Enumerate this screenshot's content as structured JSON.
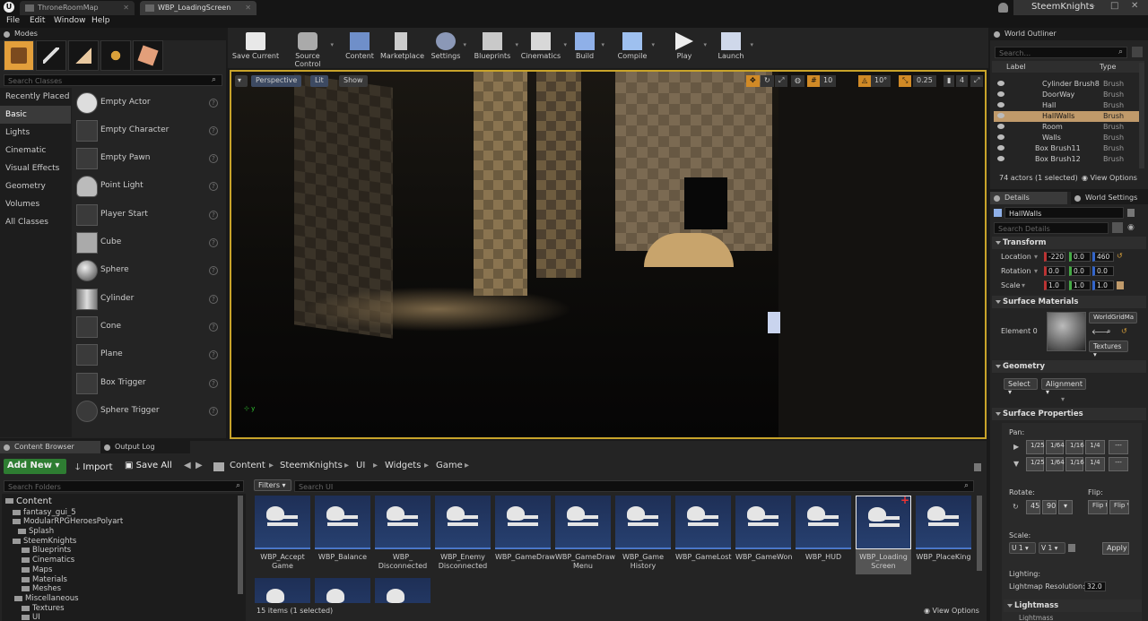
{
  "titlebar": {
    "tabs": [
      "ThroneRoomMap",
      "WBP_LoadingScreen"
    ],
    "project_name": "SteemKnights"
  },
  "menubar": [
    "File",
    "Edit",
    "Window",
    "Help"
  ],
  "modes": {
    "tab": "Modes",
    "search_placeholder": "Search Classes",
    "categories": [
      "Recently Placed",
      "Basic",
      "Lights",
      "Cinematic",
      "Visual Effects",
      "Geometry",
      "Volumes",
      "All Classes"
    ],
    "items": [
      "Empty Actor",
      "Empty Character",
      "Empty Pawn",
      "Point Light",
      "Player Start",
      "Cube",
      "Sphere",
      "Cylinder",
      "Cone",
      "Plane",
      "Box Trigger",
      "Sphere Trigger"
    ]
  },
  "toolbar": [
    {
      "label": "Save Current",
      "icon": "save-icon"
    },
    {
      "label": "Source Control",
      "icon": "source-control-icon"
    },
    {
      "label": "Content",
      "icon": "content-icon"
    },
    {
      "label": "Marketplace",
      "icon": "marketplace-icon"
    },
    {
      "label": "Settings",
      "icon": "settings-icon"
    },
    {
      "label": "Blueprints",
      "icon": "blueprints-icon"
    },
    {
      "label": "Cinematics",
      "icon": "cinematics-icon"
    },
    {
      "label": "Build",
      "icon": "build-icon"
    },
    {
      "label": "Compile",
      "icon": "compile-icon"
    },
    {
      "label": "Play",
      "icon": "play-icon"
    },
    {
      "label": "Launch",
      "icon": "launch-icon"
    }
  ],
  "viewport": {
    "perspective": "Perspective",
    "lit": "Lit",
    "show": "Show",
    "grid_snap": "10",
    "rot_snap": "10°",
    "scale_snap": "0.25",
    "cam_speed": "4"
  },
  "outliner": {
    "tab": "World Outliner",
    "search_placeholder": "Search...",
    "col_label": "Label",
    "col_type": "Type",
    "rows": [
      {
        "name": "Cylinder Brush8",
        "type": "Brush"
      },
      {
        "name": "DoorWay",
        "type": "Brush"
      },
      {
        "name": "Hall",
        "type": "Brush"
      },
      {
        "name": "HallWalls",
        "type": "Brush"
      },
      {
        "name": "Room",
        "type": "Brush"
      },
      {
        "name": "Walls",
        "type": "Brush"
      },
      {
        "name": "Box Brush11",
        "type": "Brush"
      },
      {
        "name": "Box Brush12",
        "type": "Brush"
      }
    ],
    "status": "74 actors (1 selected)",
    "view_options": "View Options"
  },
  "details": {
    "tab": "Details",
    "tab2": "World Settings",
    "name_value": "HallWalls",
    "search_placeholder": "Search Details",
    "transform": "Transform",
    "location": "Location",
    "rotation": "Rotation",
    "scale": "Scale",
    "loc_x": "-220",
    "loc_y": "0.0",
    "loc_z": "460",
    "rot_x": "0.0",
    "rot_y": "0.0",
    "rot_z": "0.0",
    "sc_x": "1.0",
    "sc_y": "1.0",
    "sc_z": "1.0",
    "surface_materials": "Surface Materials",
    "element0": "Element 0",
    "material_name": "WorldGridMa",
    "textures": "Textures",
    "geometry": "Geometry",
    "select": "Select",
    "alignment": "Alignment",
    "surface_properties": "Surface Properties",
    "pan": "Pan:",
    "pan_vals": [
      "1/25",
      "1/64",
      "1/16",
      "1/4",
      "---"
    ],
    "rotate": "Rotate:",
    "rot_v1": "45",
    "rot_v2": "90",
    "flip": "Flip:",
    "flip_u": "Flip U",
    "flip_v": "Flip V",
    "scale_lbl": "Scale:",
    "scale_u": "U 1",
    "scale_v": "V 1",
    "apply": "Apply",
    "lighting": "Lighting:",
    "lightmap_res": "Lightmap Resolution:",
    "lightmap_val": "32.0",
    "lightmass": "Lightmass",
    "lightmass_sub": "Lightmass"
  },
  "bottom_tabs": [
    "Content Browser",
    "Output Log"
  ],
  "content_browser": {
    "add_new": "Add New",
    "import": "Import",
    "save_all": "Save All",
    "breadcrumb": [
      "Content",
      "SteemKnights",
      "UI",
      "Widgets",
      "Game"
    ],
    "folder_search": "Search Folders",
    "filters": "Filters",
    "asset_search": "Search UI",
    "folders": [
      {
        "name": "Content",
        "level": 0
      },
      {
        "name": "fantasy_gui_5",
        "level": 1
      },
      {
        "name": "ModularRPGHeroesPolyart",
        "level": 1
      },
      {
        "name": "Splash",
        "level": 1
      },
      {
        "name": "SteemKnights",
        "level": 1
      },
      {
        "name": "Blueprints",
        "level": 2
      },
      {
        "name": "Cinematics",
        "level": 2
      },
      {
        "name": "Maps",
        "level": 2
      },
      {
        "name": "Materials",
        "level": 2
      },
      {
        "name": "Meshes",
        "level": 2
      },
      {
        "name": "Miscellaneous",
        "level": 2
      },
      {
        "name": "Textures",
        "level": 2
      },
      {
        "name": "UI",
        "level": 2
      }
    ],
    "assets": [
      "WBP_Accept Game",
      "WBP_Balance",
      "WBP_ Disconnected",
      "WBP_Enemy Disconnected",
      "WBP_GameDraw",
      "WBP_GameDraw Menu",
      "WBP_Game History",
      "WBP_GameLost",
      "WBP_GameWon",
      "WBP_HUD",
      "WBP_Loading Screen",
      "WBP_PlaceKing"
    ],
    "status": "15 items (1 selected)",
    "view_options": "View Options"
  }
}
